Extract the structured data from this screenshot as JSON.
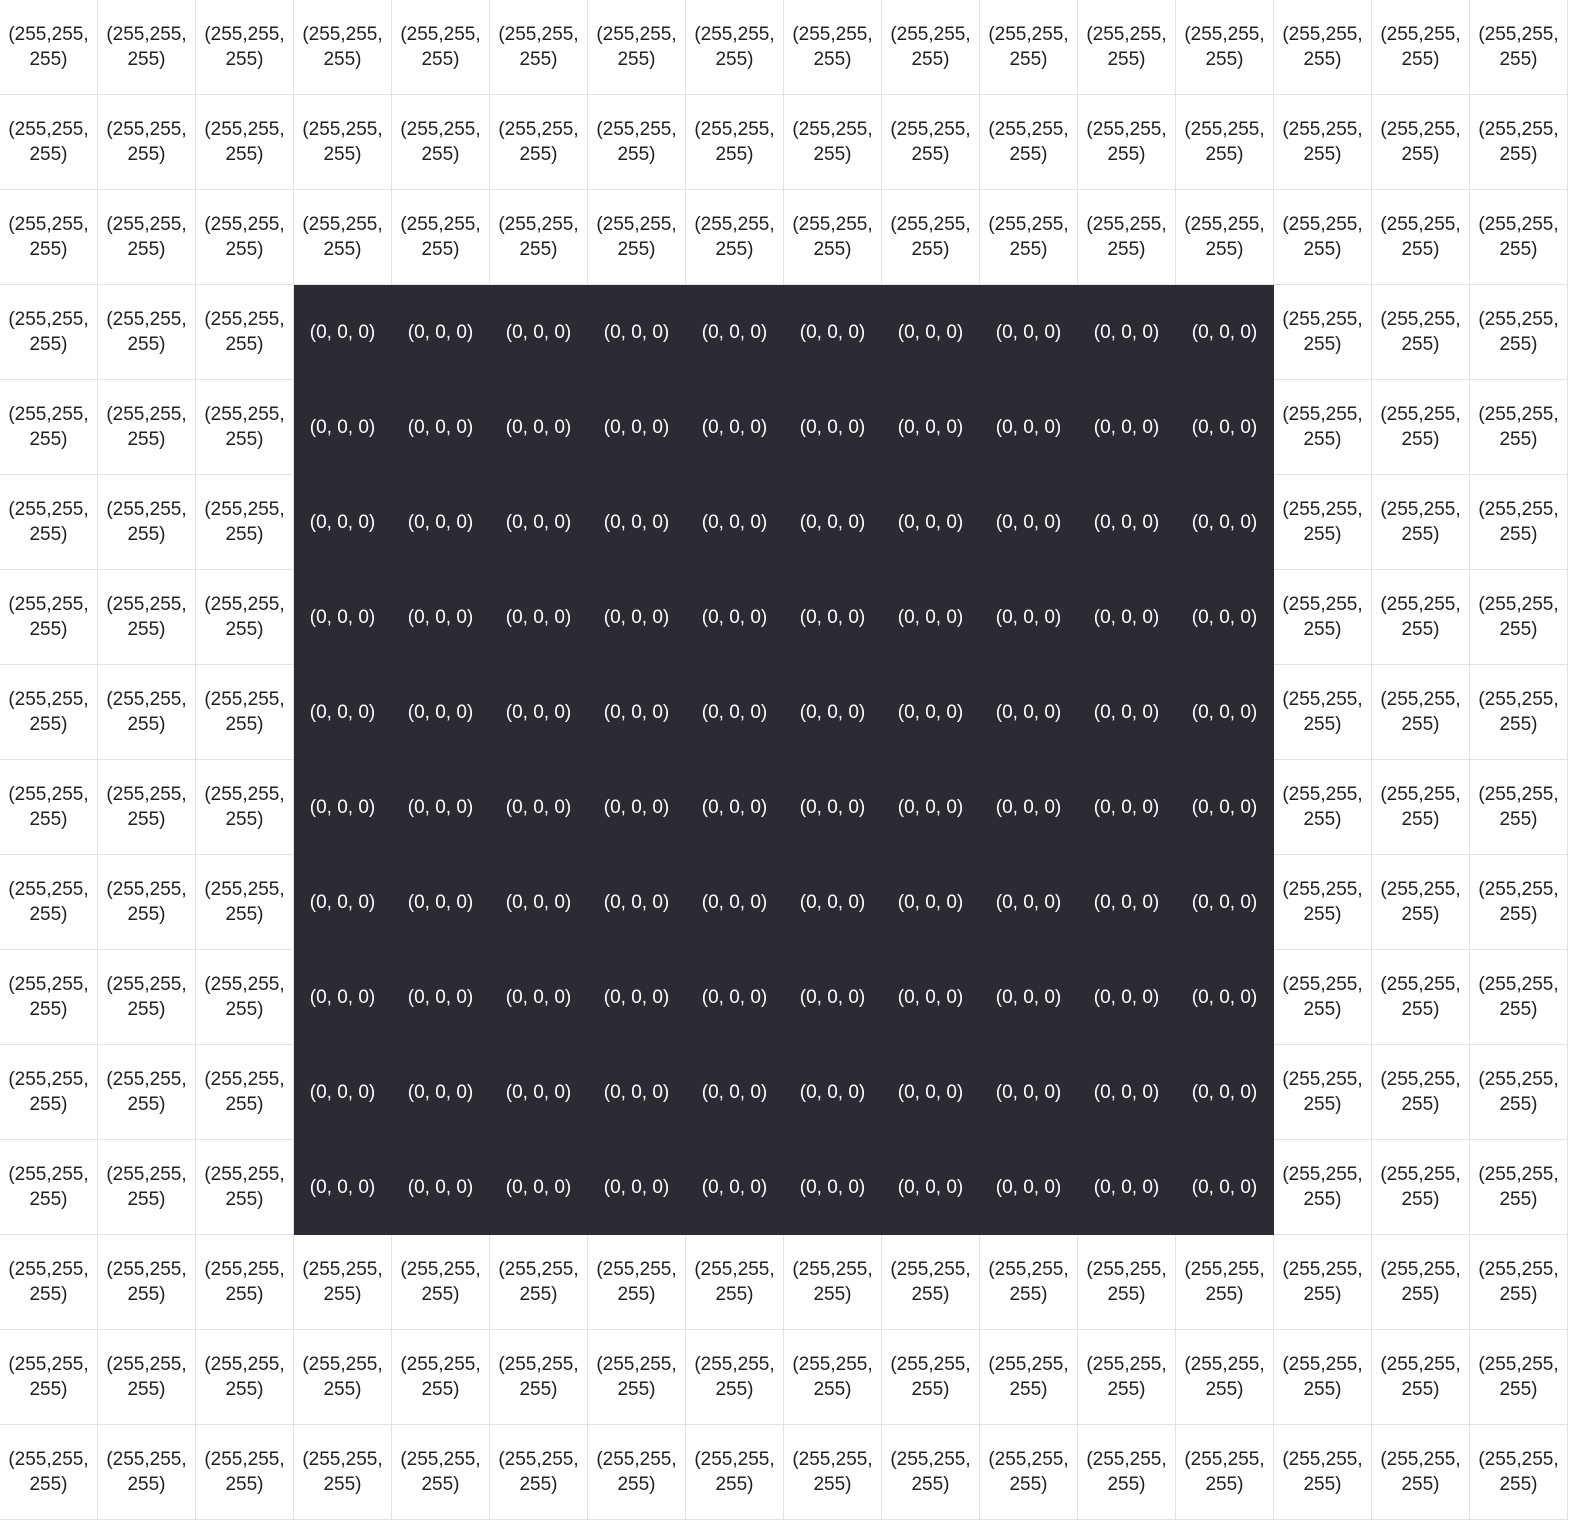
{
  "grid": {
    "rows": 16,
    "cols": 16,
    "white_label": "(255,255, 255)",
    "black_label": "(0, 0, 0)",
    "white_rgb": [
      255,
      255,
      255
    ],
    "black_rgb": [
      0,
      0,
      0
    ],
    "black_region": {
      "row_start": 3,
      "row_end": 12,
      "col_start": 3,
      "col_end": 12
    }
  },
  "colors": {
    "white_cell_bg": "#ffffff",
    "black_cell_bg": "#2b2b33",
    "white_cell_text": "#202020",
    "black_cell_text": "#ffffff",
    "grid_line": "#e3e3e3"
  }
}
